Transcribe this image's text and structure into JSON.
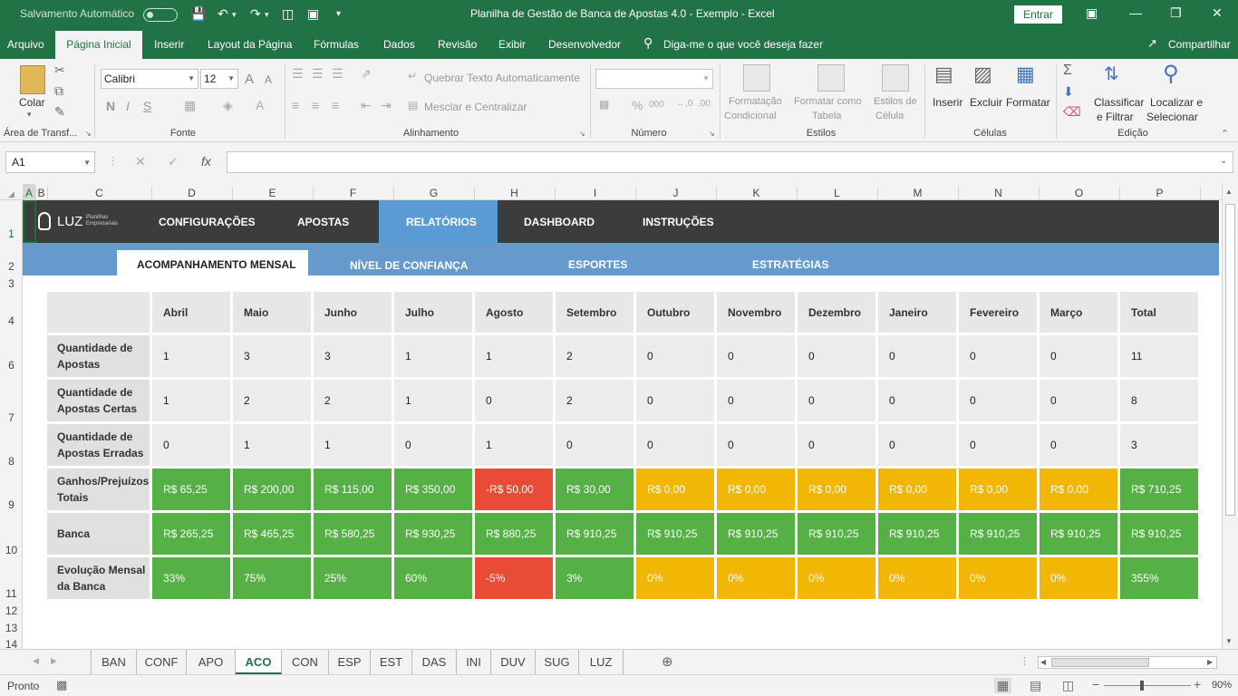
{
  "titlebar": {
    "autosave": "Salvamento Automático",
    "title": "Planilha de Gestão de Banca de Apostas 4.0 - Exemplo  -  Excel",
    "signin": "Entrar"
  },
  "menu": {
    "items": [
      "Arquivo",
      "Página Inicial",
      "Inserir",
      "Layout da Página",
      "Fórmulas",
      "Dados",
      "Revisão",
      "Exibir",
      "Desenvolvedor"
    ],
    "tell_me": "Diga-me o que você deseja fazer",
    "share": "Compartilhar"
  },
  "ribbon": {
    "paste": "Colar",
    "clipboard_group": "Área de Transf...",
    "font_name": "Calibri",
    "font_size": "12",
    "font_group": "Fonte",
    "wrap_text": "Quebrar Texto Automaticamente",
    "merge_center": "Mesclar e Centralizar",
    "alignment_group": "Alinhamento",
    "number_group": "Número",
    "cond_format_1": "Formatação",
    "cond_format_2": "Condicional",
    "format_table_1": "Formatar como",
    "format_table_2": "Tabela",
    "cell_styles_1": "Estilos de",
    "cell_styles_2": "Célula",
    "styles_group": "Estilos",
    "insert": "Inserir",
    "delete": "Excluir",
    "format": "Formatar",
    "cells_group": "Células",
    "sort_1": "Classificar",
    "sort_2": "e Filtrar",
    "find_1": "Localizar e",
    "find_2": "Selecionar",
    "editing_group": "Edição"
  },
  "formula_bar": {
    "name_box": "A1",
    "fx": "fx",
    "value": ""
  },
  "columns": [
    "A",
    "B",
    "C",
    "D",
    "E",
    "F",
    "G",
    "H",
    "I",
    "J",
    "K",
    "L",
    "M",
    "N",
    "O",
    "P"
  ],
  "rows": [
    "1",
    "2",
    "3",
    "4",
    "6",
    "7",
    "8",
    "9",
    "10",
    "11",
    "12",
    "13",
    "14"
  ],
  "nav": {
    "logo": "LUZ",
    "logo_sub_1": "Planilhas",
    "logo_sub_2": "Empresariais",
    "items": [
      "CONFIGURAÇÕES",
      "APOSTAS",
      "RELATÓRIOS",
      "DASHBOARD",
      "INSTRUÇÕES"
    ],
    "active": "RELATÓRIOS"
  },
  "subnav": {
    "items": [
      "ACOMPANHAMENTO MENSAL",
      "NÍVEL DE CONFIANÇA",
      "ESPORTES",
      "ESTRATÉGIAS"
    ],
    "active": "ACOMPANHAMENTO MENSAL"
  },
  "table": {
    "headers": [
      "",
      "Abril",
      "Maio",
      "Junho",
      "Julho",
      "Agosto",
      "Setembro",
      "Outubro",
      "Novembro",
      "Dezembro",
      "Janeiro",
      "Fevereiro",
      "Março",
      "Total"
    ],
    "rows": [
      {
        "label": "Quantidade de Apostas",
        "style": "plain",
        "values": [
          "1",
          "3",
          "3",
          "1",
          "1",
          "2",
          "0",
          "0",
          "0",
          "0",
          "0",
          "0",
          "11"
        ],
        "colors": [
          "plain",
          "plain",
          "plain",
          "plain",
          "plain",
          "plain",
          "plain",
          "plain",
          "plain",
          "plain",
          "plain",
          "plain",
          "plain"
        ]
      },
      {
        "label": "Quantidade de Apostas Certas",
        "style": "plain",
        "values": [
          "1",
          "2",
          "2",
          "1",
          "0",
          "2",
          "0",
          "0",
          "0",
          "0",
          "0",
          "0",
          "8"
        ],
        "colors": [
          "plain",
          "plain",
          "plain",
          "plain",
          "plain",
          "plain",
          "plain",
          "plain",
          "plain",
          "plain",
          "plain",
          "plain",
          "plain"
        ]
      },
      {
        "label": "Quantidade de Apostas Erradas",
        "style": "plain",
        "values": [
          "0",
          "1",
          "1",
          "0",
          "1",
          "0",
          "0",
          "0",
          "0",
          "0",
          "0",
          "0",
          "3"
        ],
        "colors": [
          "plain",
          "plain",
          "plain",
          "plain",
          "plain",
          "plain",
          "plain",
          "plain",
          "plain",
          "plain",
          "plain",
          "plain",
          "plain"
        ]
      },
      {
        "label": "Ganhos/Prejuízos Totais",
        "values": [
          "R$ 65,25",
          "R$ 200,00",
          "R$ 115,00",
          "R$ 350,00",
          "-R$ 50,00",
          "R$ 30,00",
          "R$ 0,00",
          "R$ 0,00",
          "R$ 0,00",
          "R$ 0,00",
          "R$ 0,00",
          "R$ 0,00",
          "R$ 710,25"
        ],
        "colors": [
          "green",
          "green",
          "green",
          "green",
          "red",
          "green",
          "yellow",
          "yellow",
          "yellow",
          "yellow",
          "yellow",
          "yellow",
          "green"
        ]
      },
      {
        "label": "Banca",
        "values": [
          "R$ 265,25",
          "R$ 465,25",
          "R$ 580,25",
          "R$ 930,25",
          "R$ 880,25",
          "R$ 910,25",
          "R$ 910,25",
          "R$ 910,25",
          "R$ 910,25",
          "R$ 910,25",
          "R$ 910,25",
          "R$ 910,25",
          "R$ 910,25"
        ],
        "colors": [
          "green",
          "green",
          "green",
          "green",
          "green",
          "green",
          "green",
          "green",
          "green",
          "green",
          "green",
          "green",
          "green"
        ]
      },
      {
        "label": "Evolução Mensal da Banca",
        "values": [
          "33%",
          "75%",
          "25%",
          "60%",
          "-5%",
          "3%",
          "0%",
          "0%",
          "0%",
          "0%",
          "0%",
          "0%",
          "355%"
        ],
        "colors": [
          "green",
          "green",
          "green",
          "green",
          "red",
          "green",
          "yellow",
          "yellow",
          "yellow",
          "yellow",
          "yellow",
          "yellow",
          "green"
        ]
      }
    ]
  },
  "sheet_tabs": {
    "items": [
      "BAN",
      "CONF",
      "APO",
      "ACO",
      "CON",
      "ESP",
      "EST",
      "DAS",
      "INI",
      "DUV",
      "SUG",
      "LUZ"
    ],
    "active": "ACO"
  },
  "status": {
    "ready": "Pronto",
    "zoom": "90%"
  },
  "colors": {
    "excel_green": "#217346",
    "nav_dark": "#3c3c3c",
    "nav_active": "#5b9bd5",
    "subnav": "#6699cc",
    "green_cell": "#55b045",
    "red_cell": "#e94b36",
    "yellow_cell": "#f2b705"
  }
}
